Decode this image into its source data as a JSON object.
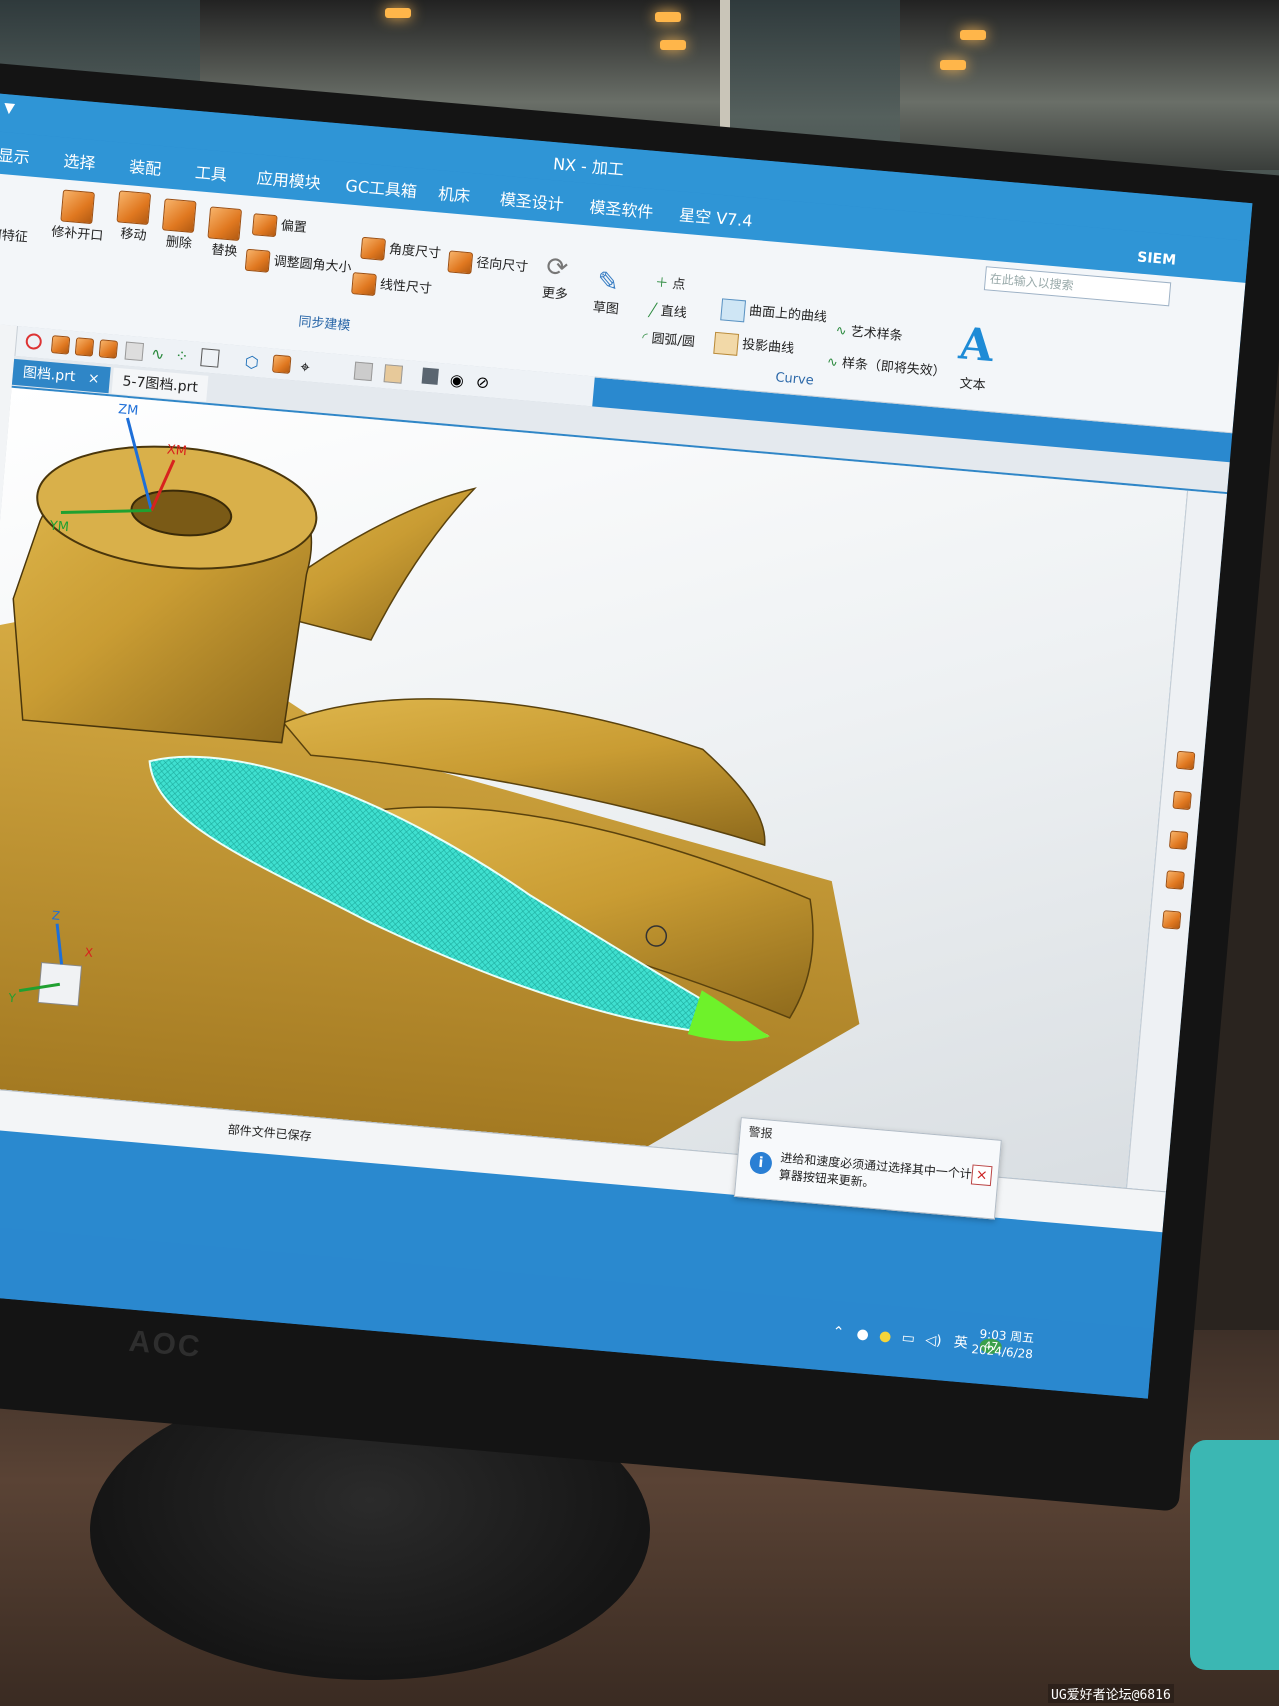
{
  "app": {
    "title": "NX - 加工",
    "qa_menu": "▼",
    "brand": "SIEM",
    "search_placeholder": "在此输入以搜索"
  },
  "menubar": {
    "items": [
      "显示",
      "选择",
      "装配",
      "工具",
      "应用模块",
      "GC工具箱",
      "机床",
      "模圣设计",
      "模圣软件",
      "星空 V7.4"
    ]
  },
  "ribbon": {
    "partial_left": "何特征",
    "buttons": {
      "repair_open": "修补开口",
      "move": "移动",
      "delete": "删除",
      "replace": "替换",
      "offset": "偏置",
      "resize_fillet": "调整圆角大小",
      "angle_dim": "角度尺寸",
      "radial_dim": "径向尺寸",
      "linear_dim": "线性尺寸",
      "more": "更多",
      "sketch": "草图",
      "point": "点",
      "line": "直线",
      "arc_circle": "圆弧/圆",
      "curve_on_surface": "曲面上的曲线",
      "projected_curve": "投影曲线",
      "art_spline": "艺术样条",
      "spline": "样条（即将失效）",
      "text": "文本",
      "text_glyph": "A"
    },
    "groups": {
      "sync_modeling": "同步建模",
      "curve": "Curve"
    }
  },
  "tabs": [
    {
      "label": "图档.prt",
      "close": "×",
      "active": true
    },
    {
      "label": "5-7图档.prt",
      "active": false
    }
  ],
  "viewport": {
    "csys_labels": {
      "zm": "ZM",
      "xm": "XM",
      "ym": "YM"
    },
    "triad_labels": {
      "z": "Z",
      "x": "X",
      "y": "Y"
    },
    "part_color": "#c9a23e",
    "toolpath_color": "#3fe0d0"
  },
  "status": {
    "message": "部件文件已保存"
  },
  "alert": {
    "title": "警报",
    "message": "进给和速度必须通过选择其中一个计算器按钮来更新。",
    "close": "×"
  },
  "taskbar": {
    "ime": "英",
    "temp": "47",
    "time": "9:03 周五",
    "date": "2024/6/28"
  },
  "monitor": {
    "brand": "AOC"
  },
  "watermark": "UG爱好者论坛@6816"
}
